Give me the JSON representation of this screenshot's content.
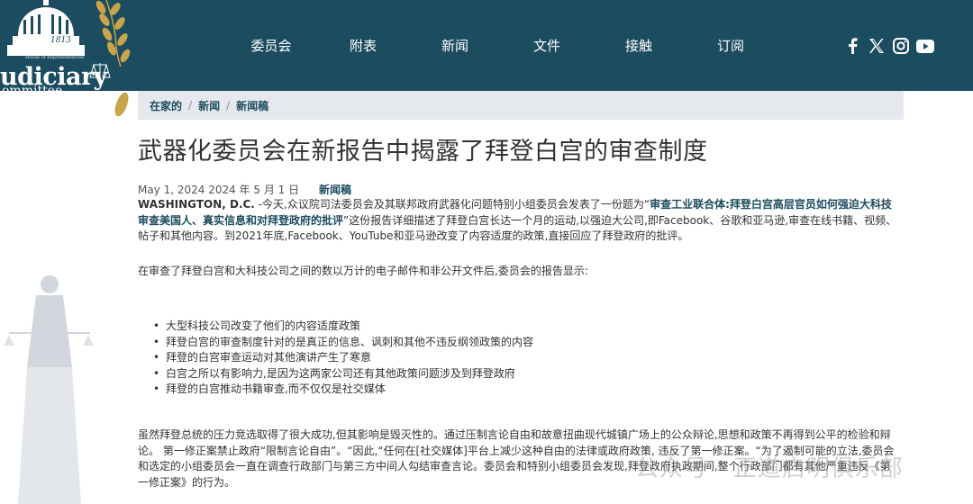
{
  "header": {
    "logo": {
      "year": "1813",
      "small_text": "House of Representatives",
      "main_text": "udiciary",
      "sub_text": "ommittee"
    },
    "nav": [
      {
        "label": "委员会"
      },
      {
        "label": "附表"
      },
      {
        "label": "新闻"
      },
      {
        "label": "文件"
      },
      {
        "label": "接触"
      },
      {
        "label": "订阅"
      }
    ],
    "social": [
      "facebook-icon",
      "x-icon",
      "instagram-icon",
      "youtube-icon"
    ]
  },
  "breadcrumb": {
    "items": [
      "在家的",
      "新闻",
      "新闻稿"
    ],
    "separator": "/"
  },
  "article": {
    "title": "武器化委员会在新报告中揭露了拜登白宫的审查制度",
    "date": "May 1, 2024 2024 年 5 月 1 日",
    "category": "新闻稿",
    "p1_dateline": "WASHINGTON, D.C.",
    "p1_pre": " -今天,众议院司法委员会及其联邦政府武器化问题特别小组委员会发表了一份题为“",
    "p1_link": "审查工业联合体:拜登白宫高层官员如何强迫大科技审查美国人、真实信息和对拜登政府的批评",
    "p1_post": "”这份报告详细描述了拜登白宫长达一个月的运动,以强迫大公司,即Facebook、谷歌和亚马逊,审查在线书籍、视频、帖子和其他内容。到2021年底,Facebook、YouTube和亚马逊改变了内容适度的政策,直接回应了拜登政府的批评。",
    "p2": "在审查了拜登白宫和大科技公司之间的数以万计的电子邮件和非公开文件后,委员会的报告显示:",
    "bullets": [
      "大型科技公司改变了他们的内容适度政策",
      "拜登白宫的审查制度针对的是真正的信息、讽刺和其他不违反纲领政策的内容",
      "拜登的白宫审查运动对其他演讲产生了寒意",
      "白宫之所以有影响力,是因为这两家公司还有其他政策问题涉及到拜登政府",
      "拜登的白宫推动书籍审查,而不仅仅是社交媒体"
    ],
    "p3": "虽然拜登总统的压力竞选取得了很大成功,但其影响是毁灭性的。通过压制言论自由和故意扭曲现代城镇广场上的公众辩论,思想和政策不再得到公平的检验和辩论。 第一修正案禁止政府“限制言论自由”。“因此,“任何在[社交媒体]平台上减少这种自由的法律或政府政策, 违反了第一修正案。“为了遏制可能的立法,委员会和选定的小组委员会一直在调查行政部门与第三方中间人勾结审查言论。委员会和特别小组委员会发现,拜登政府执政期间,整个行政部门都有其他严重违反《第一修正案》的行为。"
  },
  "watermark": {
    "text": "公众号 · 正道启明俱乐部"
  },
  "colors": {
    "header_bg": "#1c4c5f",
    "breadcrumb_bg": "#e5e8ec",
    "link": "#1c4c5f"
  }
}
